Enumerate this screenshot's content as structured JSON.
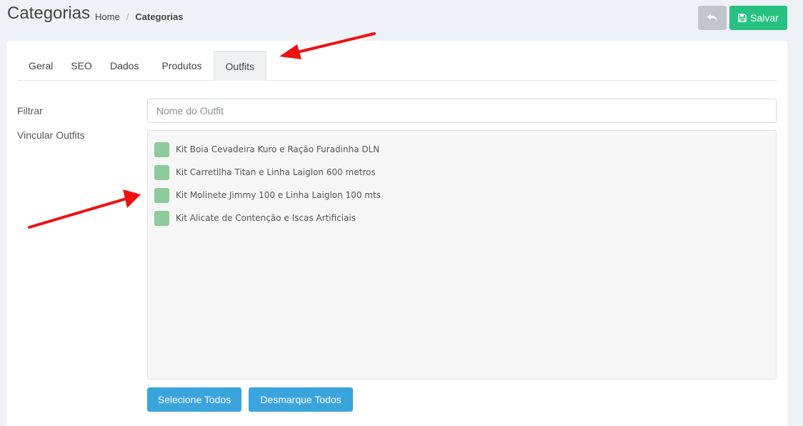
{
  "header": {
    "title": "Categorias",
    "breadcrumb": [
      {
        "label": "Home"
      },
      {
        "label": "Categorias"
      }
    ],
    "breadcrumb_separator": "/",
    "back_icon": "undo-arrow-icon",
    "save_label": "Salvar",
    "save_icon": "floppy-disk-icon"
  },
  "colors": {
    "save_green": "#27c281",
    "back_gray": "#c2c6ca",
    "action_blue": "#3aa4dc",
    "checkbox_green": "#8dcb9a",
    "annotation_red": "#ee1111"
  },
  "tabs": [
    {
      "label": "Geral"
    },
    {
      "label": "SEO"
    },
    {
      "label": "Dados"
    },
    {
      "label": "Produtos"
    },
    {
      "label": "Outfits",
      "active": true
    }
  ],
  "form": {
    "filter_label": "Filtrar",
    "filter_placeholder": "Nome do Outfit",
    "filter_value": "",
    "link_label": "Vincular Outfits",
    "outfits": [
      {
        "label": "Kit Boia Cevadeira Kuro e Ração Furadinha DLN"
      },
      {
        "label": "Kit Carretilha Titan e Linha Laiglon 600 metros"
      },
      {
        "label": "Kit Molinete Jimmy 100 e Linha Laiglon 100 mts"
      },
      {
        "label": "Kit Alicate de Contenção e Iscas Artificiais"
      }
    ],
    "select_all_label": "Selecione Todos",
    "deselect_all_label": "Desmarque Todos"
  }
}
